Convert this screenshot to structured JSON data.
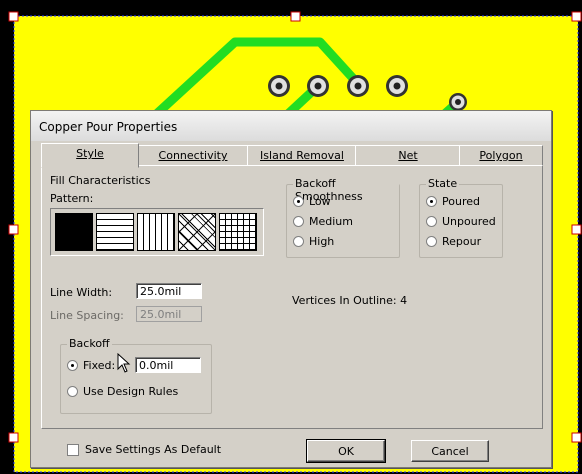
{
  "dialog": {
    "title": "Copper Pour Properties",
    "tabs": [
      {
        "label": "Style",
        "active": true
      },
      {
        "label": "Connectivity",
        "active": false
      },
      {
        "label": "Island Removal",
        "active": false
      },
      {
        "label": "Net",
        "active": false
      },
      {
        "label": "Polygon",
        "active": false
      }
    ],
    "fill": {
      "title": "Fill Characteristics",
      "pattern_label": "Pattern:",
      "patterns": [
        "solid-pattern",
        "horizontal-lines-pattern",
        "vertical-lines-pattern",
        "diagonal-crosshatch-pattern",
        "grid-pattern"
      ],
      "line_width_label": "Line Width:",
      "line_width_value": "25.0mil",
      "line_spacing_label": "Line Spacing:",
      "line_spacing_value": "25.0mil"
    },
    "backoff": {
      "title": "Backoff",
      "fixed_label": "Fixed:",
      "fixed_value": "0.0mil",
      "design_rules_label": "Use Design Rules"
    },
    "smoothness": {
      "title": "Backoff Smoothness",
      "options": [
        "Low",
        "Medium",
        "High"
      ],
      "selected": "Low"
    },
    "state": {
      "title": "State",
      "options": [
        "Poured",
        "Unpoured",
        "Repour"
      ],
      "selected": "Poured"
    },
    "vertices_text": "Vertices In Outline:  4",
    "save_default_label": "Save Settings As Default",
    "ok_label": "OK",
    "cancel_label": "Cancel"
  },
  "colors": {
    "copper": "#ffff00",
    "trace": "#22dd22",
    "background": "#000000",
    "dialog_bg": "#d4d0c8"
  }
}
